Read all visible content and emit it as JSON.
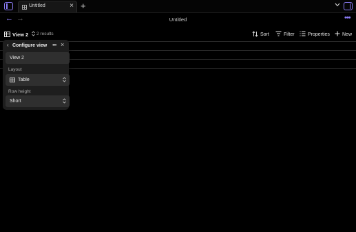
{
  "tab": {
    "title": "Untitled",
    "close": "×"
  },
  "tabbar": {
    "new_tab": "+",
    "chevron": "⌄"
  },
  "nav": {
    "back": "←",
    "forward": "→",
    "title": "Untitled",
    "more": "•••"
  },
  "toolbar": {
    "view_name": "View 2",
    "results": "2 results",
    "sort_label": "Sort",
    "filter_label": "Filter",
    "properties_label": "Properties",
    "new_label": "New"
  },
  "popup": {
    "back": "‹",
    "title": "Configure view",
    "more": "•••",
    "close": "×",
    "view_name_value": "View 2",
    "layout_label": "Layout",
    "layout_value": "Table",
    "row_height_label": "Row height",
    "row_height_value": "Short"
  },
  "colors": {
    "accent": "#8b7cf6",
    "background": "#000000",
    "popup": "#1e1e1e",
    "field": "#2f2f2f"
  },
  "icons": [
    "sidebar-toggle-icon",
    "table-icon",
    "sort-icon",
    "filter-icon",
    "list-icon",
    "plus-icon"
  ]
}
